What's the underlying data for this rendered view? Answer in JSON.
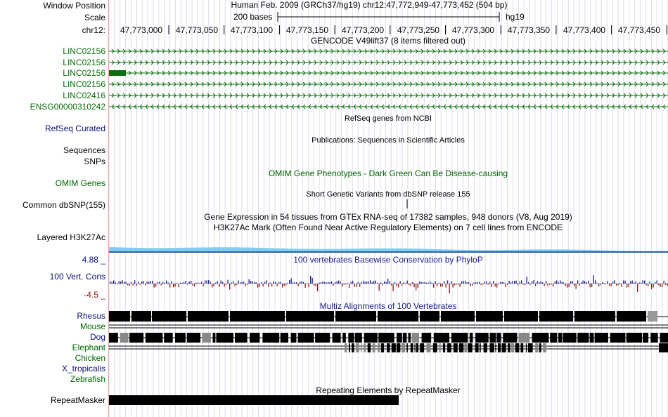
{
  "labels": {
    "window_position": "Window Position",
    "scale": "Scale",
    "chrom": "chr12:",
    "genes": [
      "LINC02156",
      "LINC02156",
      "LINC02156",
      "LINC02156",
      "LINC02416",
      "ENSG00000310242"
    ],
    "refseq": "RefSeq Curated",
    "sequences": "Sequences",
    "snps": "SNPs",
    "omim": "OMIM Genes",
    "dbsnp": "Common dbSNP(155)",
    "h3k27ac": "Layered H3K27Ac",
    "phylop_max": "4.88 _",
    "phylop_name": "100 Vert. Cons",
    "phylop_min": "-4.5 _",
    "species": [
      "Rhesus",
      "Mouse",
      "Dog",
      "Elephant",
      "Chicken",
      "X_tropicalis",
      "Zebrafish"
    ],
    "repeatmasker": "RepeatMasker"
  },
  "header": {
    "position_text": "Human Feb. 2009 (GRCh37/hg19)   chr12:47,772,949-47,773,452 (504 bp)",
    "scale_text": "200 bases",
    "assembly": "hg19",
    "ruler_ticks": [
      "47,773,000",
      "47,773,050",
      "47,773,100",
      "47,773,150",
      "47,773,200",
      "47,773,250",
      "47,773,300",
      "47,773,350",
      "47,773,400",
      "47,773,450"
    ]
  },
  "tracks": {
    "gencode_title": "GENCODE V49lift37 (8 items filtered out)",
    "refseq_title": "RefSeq genes from NCBI",
    "publications_title": "Publications: Sequences in Scientific Articles",
    "omim_title": "OMIM Gene Phenotypes - Dark Green Can Be Disease-causing",
    "dbsnp_title": "Short Genetic Variants from dbSNP release 155",
    "gtex_title": "Gene Expression in 54 tissues from GTEx RNA-seq of 17382 samples, 948 donors (V8, Aug 2019)",
    "h3k27ac_title": "H3K27Ac Mark (Often Found Near Active Regulatory Elements) on 7 cell lines from ENCODE",
    "phylop_title": "100 vertebrates Basewise Conservation by PhyloP",
    "multiz_title": "Multiz Alignments of 100 Vertebrates",
    "repeatmasker_title": "Repeating Elements by RepeatMasker"
  },
  "colors": {
    "gene_green": "#0b6e0b",
    "refseq_blue": "#0c0c78",
    "omim_green": "#006400",
    "phylop_pos": "#1a1a8c",
    "phylop_neg": "#8b1a1a",
    "h3k27ac": "#7fd0f0",
    "grid": "#dcdcf0"
  }
}
